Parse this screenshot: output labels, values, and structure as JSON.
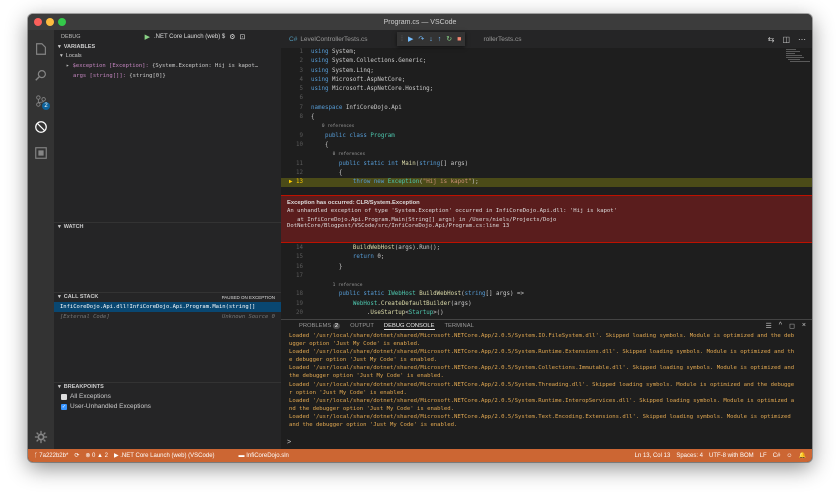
{
  "window": {
    "title": "Program.cs — VSCode"
  },
  "colors": {
    "accent": "#0e639c",
    "status_bar": "#cc6633",
    "exception_bg": "#5a1d1d"
  },
  "sidebar": {
    "debug_label": "DEBUG",
    "config_label": ".NET Core Launch (web) $",
    "variables_header": "VARIABLES",
    "locals_label": "Locals",
    "locals": [
      {
        "name": "$exception [Exception]:",
        "value": "{System.Exception: Hij is kapot…"
      },
      {
        "name": "args [string[]]:",
        "value": "{string[0]}"
      }
    ],
    "watch_header": "WATCH",
    "callstack_header": "CALL STACK",
    "callstack_status": "PAUSED ON EXCEPTION",
    "callstack_items": [
      {
        "frame": "InfiCoreDojo.Api.dll!InfiCoreDojo.Api.Program.Main(string[]",
        "source": ""
      },
      {
        "frame": "[External Code]",
        "source": "Unknown Source 0"
      }
    ],
    "breakpoints_header": "BREAKPOINTS",
    "breakpoints": [
      {
        "label": "All Exceptions",
        "checked": false
      },
      {
        "label": "User-Unhandled Exceptions",
        "checked": true
      }
    ]
  },
  "tabs": [
    {
      "label": "LevelControllerTests.cs",
      "active": false
    },
    {
      "label": "rollerTests.cs",
      "active": false
    }
  ],
  "code": {
    "lines_top": [
      {
        "n": "1",
        "html_parts": [
          [
            "kw",
            "using "
          ],
          [
            "",
            "System;"
          ]
        ]
      },
      {
        "n": "2",
        "html_parts": [
          [
            "kw",
            "using "
          ],
          [
            "",
            "System.Collections.Generic;"
          ]
        ]
      },
      {
        "n": "3",
        "html_parts": [
          [
            "kw",
            "using "
          ],
          [
            "",
            "System.Linq;"
          ]
        ]
      },
      {
        "n": "4",
        "html_parts": [
          [
            "kw",
            "using "
          ],
          [
            "",
            "Microsoft.AspNetCore;"
          ]
        ]
      },
      {
        "n": "5",
        "html_parts": [
          [
            "kw",
            "using "
          ],
          [
            "",
            "Microsoft.AspNetCore.Hosting;"
          ]
        ]
      },
      {
        "n": "6",
        "html_parts": [
          [
            "",
            ""
          ]
        ]
      },
      {
        "n": "7",
        "html_parts": [
          [
            "kw",
            "namespace "
          ],
          [
            "",
            "InfiCoreDojo.Api"
          ]
        ]
      },
      {
        "n": "8",
        "html_parts": [
          [
            "",
            "{"
          ]
        ]
      },
      {
        "n": "",
        "html_parts": [
          [
            "cm",
            "    0 references"
          ]
        ]
      },
      {
        "n": "9",
        "html_parts": [
          [
            "kw",
            "    public class "
          ],
          [
            "ty",
            "Program"
          ]
        ]
      },
      {
        "n": "10",
        "html_parts": [
          [
            "",
            "    {"
          ]
        ]
      },
      {
        "n": "",
        "html_parts": [
          [
            "cm",
            "        0 references"
          ]
        ]
      },
      {
        "n": "11",
        "html_parts": [
          [
            "kw",
            "        public static int "
          ],
          [
            "mt",
            "Main"
          ],
          [
            "",
            "("
          ],
          [
            "kw",
            "string"
          ],
          [
            "",
            "[] args)"
          ]
        ]
      },
      {
        "n": "12",
        "html_parts": [
          [
            "",
            "        {"
          ]
        ]
      },
      {
        "n": "13",
        "html_parts": [
          [
            "kw",
            "            throw new "
          ],
          [
            "ty",
            "Exception"
          ],
          [
            "",
            "("
          ],
          [
            "st",
            "\"Hij is kapot\""
          ],
          [
            "",
            ");"
          ]
        ]
      }
    ],
    "lines_bottom": [
      {
        "n": "14",
        "html_parts": [
          [
            "mt",
            "            BuildWebHost"
          ],
          [
            "",
            "(args).Run();"
          ]
        ]
      },
      {
        "n": "15",
        "html_parts": [
          [
            "kw",
            "            return "
          ],
          [
            "",
            "0;"
          ]
        ]
      },
      {
        "n": "16",
        "html_parts": [
          [
            "",
            "        }"
          ]
        ]
      },
      {
        "n": "17",
        "html_parts": [
          [
            "",
            ""
          ]
        ]
      },
      {
        "n": "",
        "html_parts": [
          [
            "cm",
            "        1 reference"
          ]
        ]
      },
      {
        "n": "18",
        "html_parts": [
          [
            "kw",
            "        public static "
          ],
          [
            "ty",
            "IWebHost "
          ],
          [
            "mt",
            "BuildWebHost"
          ],
          [
            "",
            "("
          ],
          [
            "kw",
            "string"
          ],
          [
            "",
            "[] args) =>"
          ]
        ]
      },
      {
        "n": "19",
        "html_parts": [
          [
            "ty",
            "            WebHost"
          ],
          [
            "",
            "."
          ],
          [
            "mt",
            "CreateDefaultBuilder"
          ],
          [
            "",
            "(args)"
          ]
        ]
      },
      {
        "n": "20",
        "html_parts": [
          [
            "",
            "                ."
          ],
          [
            "mt",
            "UseStartup"
          ],
          [
            "",
            "<"
          ],
          [
            "ty",
            "Startup"
          ],
          [
            "",
            ">()"
          ]
        ]
      }
    ]
  },
  "exception": {
    "title": "Exception has occurred: CLR/System.Exception",
    "message": "An unhandled exception of type 'System.Exception' occurred in InfiCoreDojo.Api.dll: 'Hij is kapot'",
    "trace1": "   at InfiCoreDojo.Api.Program.Main(String[] args) in /Users/niels/Projects/Dojo",
    "trace2": "DotNetCore/Blogpost/VSCode/src/InfiCoreDojo.Api/Program.cs:line 13"
  },
  "panel": {
    "tabs": [
      {
        "label": "PROBLEMS",
        "badge": "2",
        "active": false
      },
      {
        "label": "OUTPUT",
        "active": false
      },
      {
        "label": "DEBUG CONSOLE",
        "active": true
      },
      {
        "label": "TERMINAL",
        "active": false
      }
    ],
    "output_lines": [
      "Loaded '/usr/local/share/dotnet/shared/Microsoft.NETCore.App/2.0.5/System.IO.FileSystem.dll'. Skipped loading symbols. Module is optimized and the deb",
      "ugger option 'Just My Code' is enabled.",
      "Loaded '/usr/local/share/dotnet/shared/Microsoft.NETCore.App/2.0.5/System.Runtime.Extensions.dll'. Skipped loading symbols. Module is optimized and th",
      "e debugger option 'Just My Code' is enabled.",
      "Loaded '/usr/local/share/dotnet/shared/Microsoft.NETCore.App/2.0.5/System.Collections.Immutable.dll'. Skipped loading symbols. Module is optimized and",
      "the debugger option 'Just My Code' is enabled.",
      "Loaded '/usr/local/share/dotnet/shared/Microsoft.NETCore.App/2.0.5/System.Threading.dll'. Skipped loading symbols. Module is optimized and the debugge",
      "r option 'Just My Code' is enabled.",
      "Loaded '/usr/local/share/dotnet/shared/Microsoft.NETCore.App/2.0.5/System.Runtime.InteropServices.dll'. Skipped loading symbols. Module is optimized a",
      "nd the debugger option 'Just My Code' is enabled.",
      "Loaded '/usr/local/share/dotnet/shared/Microsoft.NETCore.App/2.0.5/System.Text.Encoding.Extensions.dll'. Skipped loading symbols. Module is optimized",
      "and the debugger option 'Just My Code' is enabled."
    ],
    "prompt": ">"
  },
  "status": {
    "branch": "7a222b2b*",
    "sync": "⟳",
    "errors": "⊗ 0 ▲ 2",
    "launch": "▶ .NET Core Launch (web) (VSCode)",
    "solution": "InfiCoreDojo.sln",
    "position": "Ln 13, Col 13",
    "spaces": "Spaces: 4",
    "encoding": "UTF-8 with BOM",
    "eol": "LF",
    "language": "C#"
  }
}
